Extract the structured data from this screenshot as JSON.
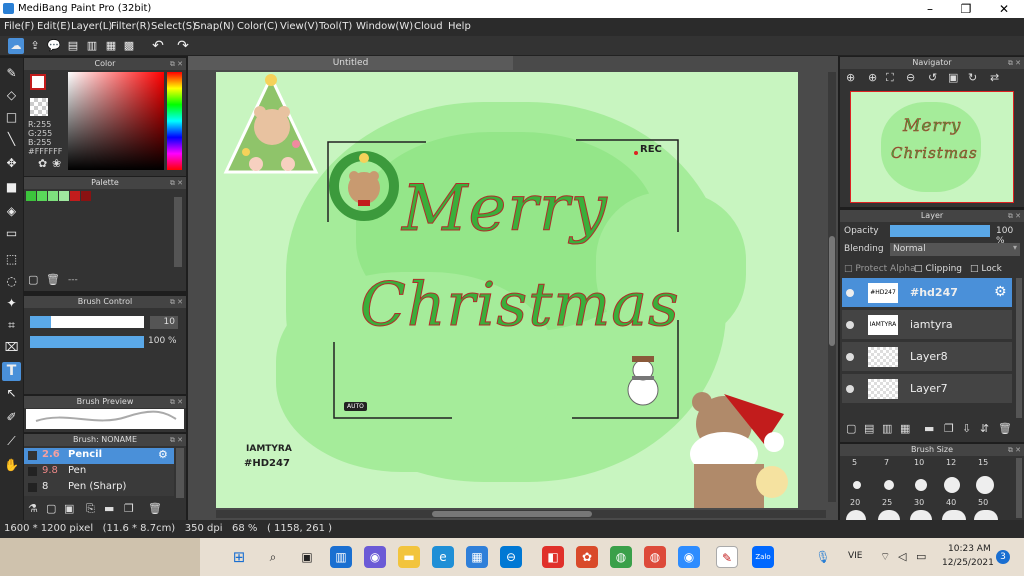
{
  "window": {
    "title": "MediBang Paint Pro (32bit)"
  },
  "menu": [
    "File(F)",
    "Edit(E)",
    "Layer(L)",
    "Filter(R)",
    "Select(S)",
    "Snap(N)",
    "Color(C)",
    "View(V)",
    "Tool(T)",
    "Window(W)",
    "Cloud",
    "Help"
  ],
  "color_panel": {
    "title": "Color",
    "r": "R:255",
    "g": "G:255",
    "b": "B:255",
    "hex": "#FFFFFF"
  },
  "palette_panel": {
    "title": "Palette",
    "dash": "---",
    "swatches": [
      "#3cc43c",
      "#5ad85a",
      "#7ee07e",
      "#a0e8a0",
      "#c21c1c",
      "#8a1212"
    ]
  },
  "brush_control": {
    "title": "Brush Control",
    "size": "10",
    "opacity": "100 %",
    "size_fill": 0.18,
    "opacity_fill": 1.0
  },
  "brush_preview": {
    "title": "Brush Preview"
  },
  "brush_list": {
    "title": "Brush: NONAME",
    "items": [
      {
        "size": "2.6",
        "name": "Pencil",
        "selected": true
      },
      {
        "size": "9.8",
        "name": "Pen",
        "selected": false
      },
      {
        "size": "8",
        "name": "Pen (Sharp)",
        "selected": false
      }
    ]
  },
  "document": {
    "tab": "Untitled"
  },
  "artwork": {
    "line1": "Merry",
    "line2": "Christmas",
    "rec": "REC",
    "auto": "AUTO",
    "signature_1": "IAMTYRA",
    "signature_2": "#HD247"
  },
  "navigator": {
    "title": "Navigator"
  },
  "layer_panel": {
    "title": "Layer",
    "opacity_label": "Opacity",
    "opacity_value": "100 %",
    "blending_label": "Blending",
    "blending_value": "Normal",
    "protect_alpha": "Protect Alpha",
    "clipping": "Clipping",
    "lock": "Lock",
    "layers": [
      {
        "name": "#hd247",
        "thumb": "#HD247",
        "selected": true
      },
      {
        "name": "iamtyra",
        "thumb": "IAMTYRA",
        "selected": false
      },
      {
        "name": "Layer8",
        "thumb": "",
        "selected": false
      },
      {
        "name": "Layer7",
        "thumb": "",
        "selected": false
      }
    ]
  },
  "brush_size_panel": {
    "title": "Brush Size",
    "row1": [
      "5",
      "7",
      "10",
      "12",
      "15"
    ],
    "row2": [
      "20",
      "25",
      "30",
      "40",
      "50"
    ]
  },
  "status": {
    "text": "1600 * 1200 pixel   (11.6 * 8.7cm)   350 dpi   68 %   ( 1158, 261 )"
  },
  "taskbar": {
    "lang": "VIE",
    "time": "10:23 AM",
    "date": "12/25/2021",
    "badge": "3"
  }
}
